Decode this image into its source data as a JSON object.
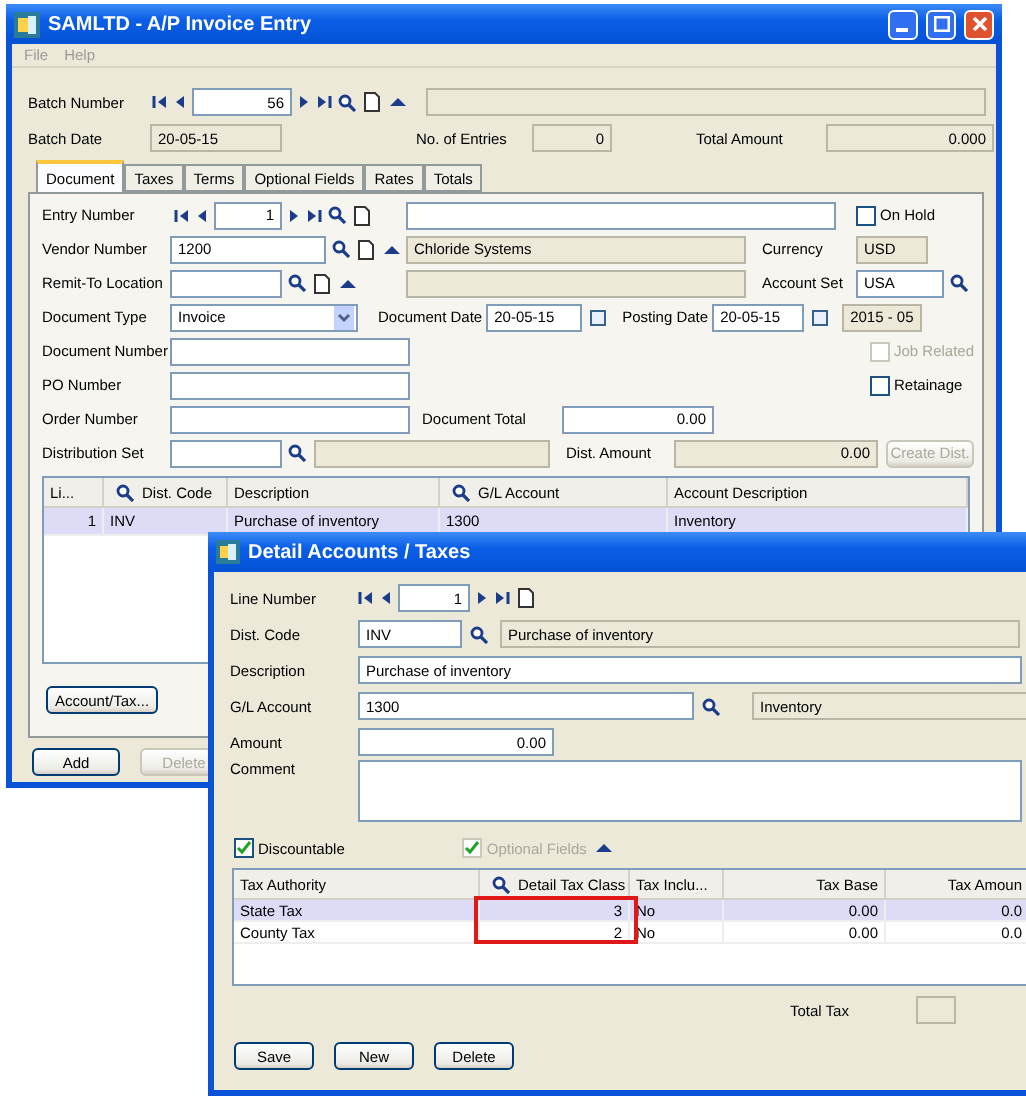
{
  "main_window": {
    "title": "SAMLTD - A/P Invoice Entry",
    "menu": [
      "File",
      "Help"
    ],
    "batch": {
      "number_label": "Batch Number",
      "number": "56",
      "date_label": "Batch Date",
      "date": "20-05-15",
      "entries_label": "No. of Entries",
      "entries": "0",
      "total_label": "Total Amount",
      "total": "0.000"
    },
    "tabs": [
      {
        "label": "Document",
        "selected": true
      },
      {
        "label": "Taxes",
        "selected": false
      },
      {
        "label": "Terms",
        "selected": false
      },
      {
        "label": "Optional Fields",
        "selected": false
      },
      {
        "label": "Rates",
        "selected": false
      },
      {
        "label": "Totals",
        "selected": false
      }
    ],
    "document": {
      "entry_number": {
        "label": "Entry Number",
        "value": "1"
      },
      "on_hold": {
        "label": "On Hold",
        "checked": false
      },
      "vendor_number": {
        "label": "Vendor Number",
        "value": "1200",
        "name": "Chloride Systems"
      },
      "currency": {
        "label": "Currency",
        "value": "USD"
      },
      "remit_to": {
        "label": "Remit-To Location"
      },
      "account_set": {
        "label": "Account Set",
        "value": "USA"
      },
      "document_type": {
        "label": "Document Type",
        "value": "Invoice"
      },
      "document_date": {
        "label": "Document Date",
        "value": "20-05-15"
      },
      "posting_date": {
        "label": "Posting Date",
        "value": "20-05-15"
      },
      "period": "2015 - 05",
      "document_number": {
        "label": "Document Number"
      },
      "job_related": {
        "label": "Job Related",
        "checked": false,
        "disabled": true
      },
      "po_number": {
        "label": "PO Number"
      },
      "retainage": {
        "label": "Retainage",
        "checked": false,
        "disabled": false
      },
      "order_number": {
        "label": "Order Number"
      },
      "document_total": {
        "label": "Document Total",
        "value": "0.00"
      },
      "distribution_set": {
        "label": "Distribution Set"
      },
      "dist_amount": {
        "label": "Dist. Amount",
        "value": "0.00"
      },
      "create_dist": {
        "label": "Create Dist.",
        "disabled": true
      }
    },
    "grid": {
      "columns": [
        {
          "label": "Li...",
          "lookup": false
        },
        {
          "label": "Dist. Code",
          "lookup": true
        },
        {
          "label": "Description",
          "lookup": false
        },
        {
          "label": "G/L Account",
          "lookup": true
        },
        {
          "label": "Account Description",
          "lookup": false
        }
      ],
      "rows": [
        {
          "cells": [
            "1",
            "INV",
            "Purchase of inventory",
            "1300",
            "Inventory"
          ],
          "selected": true
        }
      ]
    },
    "account_tax_button": {
      "label": "Account/Tax...",
      "disabled": false
    },
    "actions": [
      {
        "label": "Add",
        "disabled": false
      },
      {
        "label": "Delete",
        "disabled": true
      }
    ]
  },
  "dialog": {
    "title": "Detail Accounts / Taxes",
    "line_number": {
      "label": "Line Number",
      "value": "1"
    },
    "dist_code": {
      "label": "Dist. Code",
      "value": "INV",
      "description": "Purchase of inventory"
    },
    "description": {
      "label": "Description",
      "value": "Purchase of inventory"
    },
    "gl_account": {
      "label": "G/L Account",
      "value": "1300",
      "description": "Inventory"
    },
    "amount": {
      "label": "Amount",
      "value": "0.00"
    },
    "comment": {
      "label": "Comment"
    },
    "discountable": {
      "label": "Discountable",
      "checked": true,
      "disabled": false
    },
    "optional_fields": {
      "label": "Optional Fields",
      "checked": true,
      "disabled": true
    },
    "tax_grid": {
      "columns": [
        {
          "label": "Tax Authority",
          "lookup": false
        },
        {
          "label": "Detail Tax Class",
          "lookup": true
        },
        {
          "label": "Tax Inclu...",
          "lookup": false
        },
        {
          "label": "Tax Base",
          "lookup": false
        },
        {
          "label": "Tax Amoun",
          "lookup": false
        }
      ],
      "rows": [
        {
          "cells": [
            "State Tax",
            "3",
            "No",
            "0.00",
            "0.0"
          ],
          "selected": true
        },
        {
          "cells": [
            "County Tax",
            "2",
            "No",
            "0.00",
            "0.0"
          ],
          "selected": false
        }
      ]
    },
    "total_tax": {
      "label": "Total Tax"
    },
    "buttons": [
      {
        "label": "Save"
      },
      {
        "label": "New"
      },
      {
        "label": "Delete"
      }
    ]
  }
}
